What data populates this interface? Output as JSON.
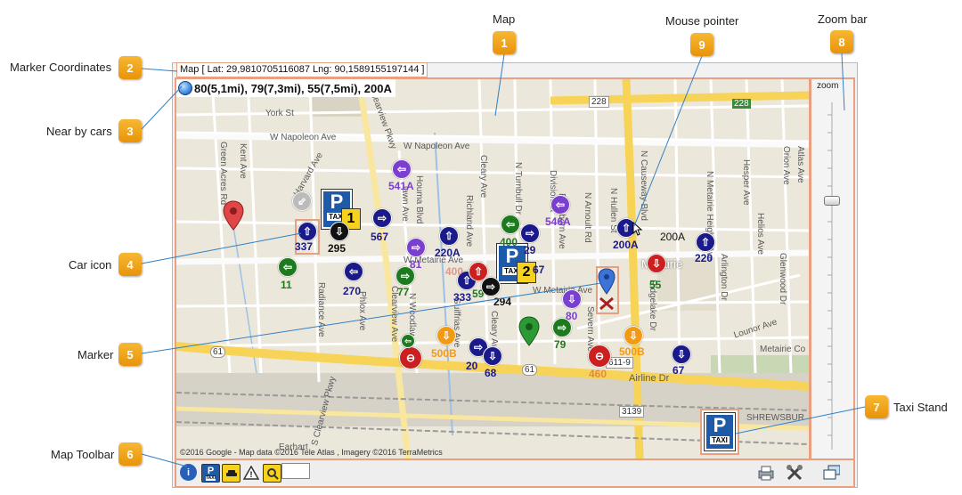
{
  "callouts": {
    "marker_coordinates": {
      "label": "Marker Coordinates",
      "num": "2"
    },
    "near_by_cars": {
      "label": "Near by cars",
      "num": "3"
    },
    "car_icon": {
      "label": "Car icon",
      "num": "4"
    },
    "marker": {
      "label": "Marker",
      "num": "5"
    },
    "map_toolbar": {
      "label": "Map Toolbar",
      "num": "6"
    },
    "map": {
      "label": "Map",
      "num": "1"
    },
    "mouse_pointer": {
      "label": "Mouse pointer",
      "num": "9"
    },
    "zoom_bar": {
      "label": "Zoom bar",
      "num": "8"
    },
    "taxi_stand": {
      "label": "Taxi Stand",
      "num": "7"
    }
  },
  "map": {
    "coordinates_text": "Map [ Lat: 29,9810705116087   Lng: 90,1589155197144 ]",
    "nearby_text": "80(5,1mi), 79(7,3mi), 55(7,5mi), 200A",
    "credit": "©2016 Google - Map data ©2016 Tele Atlas , Imagery ©2016 TerraMetrics",
    "streets": {
      "york": "York St",
      "w_napoleon_1": "W Napoleon Ave",
      "w_napoleon_2": "W Napoleon Ave",
      "w_metairie": "W Metairie Ave",
      "w_metairie_2": "W Metairie Ave",
      "airline": "Airline Dr",
      "metairie": "Metairie",
      "lounor": "Lounor Ave",
      "clearview": "Clearview Pkwy",
      "s_clearview": "S Clearview Pkwy",
      "harvard": "Harvard Ave",
      "green_acres": "Green Acres Rd",
      "kent": "Kent Ave",
      "houma": "Houma Blvd",
      "richland": "Richland Ave",
      "cleary": "Cleary Ave",
      "n_turnbull": "N Turnbull Dr",
      "n_causeway": "N Causeway Blvd",
      "n_hullen": "N Hullen St",
      "n_arnoult": "N Arnoult Rd",
      "division": "Division St",
      "n_heights": "N Metairie Heights Ave",
      "arlington": "Arlington Dr",
      "helios": "Helios Ave",
      "hesper": "Hesper Ave",
      "glenwood": "Glenwood Dr",
      "orion": "Orion Ave",
      "atlas": "Atlas Ave",
      "radiance": "Radiance Ave",
      "phlox": "Phlox Ave",
      "clearview_ave": "Clearview Ave",
      "n_woodlawn": "N Woodlawn Ave",
      "guiffrias": "Guiffrias Ave",
      "ridgelake": "Ridgelake Dr",
      "severn": "Severn Ave",
      "shrewsbury": "SHREWSBUR",
      "metairie_cc": "Metairie Co",
      "edenborn": "Edenborn Ave",
      "cleary_ave": "Cleary Ave",
      "lawn": "lawn Ave",
      "earhart": "Earhart",
      "rd_611": "611-9"
    },
    "shields": {
      "i10a": "228",
      "i10b": "228",
      "us61a": "61",
      "us61b": "61",
      "r3139": "3139"
    },
    "cars": [
      {
        "id": "c1",
        "label": "541A",
        "color": "#7b3fd0"
      },
      {
        "id": "c2",
        "label": "567",
        "color": "#1a1a8a"
      },
      {
        "id": "c3",
        "label": "337",
        "color": "#1a1a8a"
      },
      {
        "id": "c4",
        "label": "295",
        "color": "#111111"
      },
      {
        "id": "c5",
        "label": "81",
        "color": "#7b3fd0"
      },
      {
        "id": "c6",
        "label": "220A",
        "color": "#1a1a8a"
      },
      {
        "id": "c7",
        "label": "11",
        "color": "#1e7a1e"
      },
      {
        "id": "c8",
        "label": "270",
        "color": "#1a1a8a"
      },
      {
        "id": "c9",
        "label": "77",
        "color": "#1e7a1e"
      },
      {
        "id": "c10",
        "label": "400",
        "color": "#1e7a1e"
      },
      {
        "id": "c11",
        "label": "333",
        "color": "#1a1a8a"
      },
      {
        "id": "c12",
        "label": "59",
        "color": "#1e7a1e"
      },
      {
        "id": "c13",
        "label": "294",
        "color": "#111111"
      },
      {
        "id": "c14",
        "label": "29",
        "color": "#1a1a8a"
      },
      {
        "id": "c15",
        "label": "67",
        "color": "#1a1a8a"
      },
      {
        "id": "c16",
        "label": "546A",
        "color": "#7b3fd0"
      },
      {
        "id": "c17",
        "label": "200A",
        "color": "#1a1a8a"
      },
      {
        "id": "c18",
        "label": "200A",
        "color": "#111111"
      },
      {
        "id": "c19",
        "label": "220",
        "color": "#1a1a8a"
      },
      {
        "id": "c20",
        "label": "55",
        "color": "#1e7a1e"
      },
      {
        "id": "c21",
        "label": "80",
        "color": "#7b3fd0"
      },
      {
        "id": "c22",
        "label": "79",
        "color": "#1e7a1e"
      },
      {
        "id": "c23",
        "label": "500B",
        "color": "#f39a12"
      },
      {
        "id": "c24",
        "label": "20",
        "color": "#1a1a8a"
      },
      {
        "id": "c25",
        "label": "68",
        "color": "#1a1a8a"
      },
      {
        "id": "c26",
        "label": "500B",
        "color": "#f39a12"
      },
      {
        "id": "c27",
        "label": "67",
        "color": "#1a1a8a"
      },
      {
        "id": "c28",
        "label": "400",
        "color": "#cc2020"
      },
      {
        "id": "c29",
        "label": "460",
        "color": "#cc2020"
      }
    ],
    "taxi_stand_1_count": "1",
    "taxi_stand_2_count": "2",
    "taxi_label": "TAXI",
    "parking_letter": "P"
  },
  "zoom": {
    "label": "zoom"
  },
  "toolbar": {
    "info": "i",
    "parking": "P",
    "taxi": "TAXI",
    "warning": "!",
    "search": "?"
  },
  "colors": {
    "callout": "#f0a020",
    "highlight": "#e8a080",
    "map_bg": "#ece7db",
    "highway": "#f7d358"
  }
}
